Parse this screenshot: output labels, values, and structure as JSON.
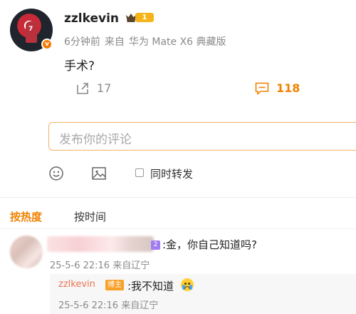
{
  "post": {
    "username": "zzlkevin",
    "level": "1",
    "verified_badge": "v",
    "time": "6分钟前",
    "source_prefix": "来自",
    "device": "华为 Mate X6 典藏版",
    "text": "手术?",
    "repost_count": "17",
    "comment_count": "118"
  },
  "composer": {
    "placeholder": "发布你的评论",
    "repost_label": "同时转发"
  },
  "sort_tabs": {
    "hot": "按热度",
    "time": "按时间"
  },
  "comment": {
    "level": "2",
    "text": ":金，你自己知道吗?",
    "time": "25-5-6 22:16",
    "location": "来自辽宁"
  },
  "reply": {
    "username": "zzlkevin",
    "badge": "博主",
    "text": ":我不知道",
    "time": "25-5-6 22:16",
    "location": "来自辽宁"
  },
  "colors": {
    "accent": "#f08200",
    "reply_name": "#eb7350",
    "level_badge": "#f6b41a"
  },
  "icons": [
    "crown-icon",
    "repost-icon",
    "comment-icon",
    "emoji-icon",
    "image-icon",
    "crying-emoji-icon"
  ]
}
